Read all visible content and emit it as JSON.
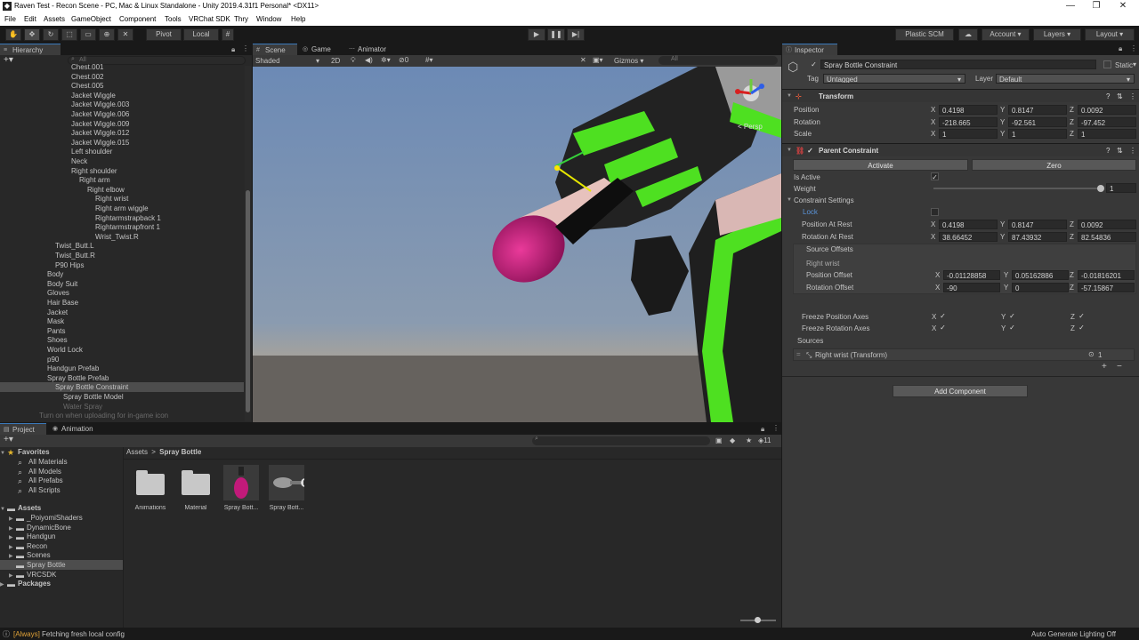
{
  "window": {
    "title": "Raven Test - Recon Scene - PC, Mac & Linux Standalone - Unity 2019.4.31f1 Personal* <DX11>"
  },
  "menu": [
    "File",
    "Edit",
    "Assets",
    "GameObject",
    "Component",
    "Tools",
    "VRChat SDK",
    "Thry",
    "Window",
    "Help"
  ],
  "toolbar": {
    "pivot": "Pivot",
    "local": "Local",
    "plastic": "Plastic SCM",
    "account": "Account",
    "layers": "Layers",
    "layout": "Layout"
  },
  "hierarchy": {
    "tab": "Hierarchy",
    "search_placeholder": "All",
    "rows": [
      {
        "label": "Chest.001",
        "indent": 0,
        "arrow": "",
        "style": "cut"
      },
      {
        "label": "Chest.002",
        "indent": 0,
        "arrow": "▶"
      },
      {
        "label": "Chest.005",
        "indent": 0,
        "arrow": "▶"
      },
      {
        "label": "Jacket Wiggle",
        "indent": 0,
        "arrow": "▶"
      },
      {
        "label": "Jacket Wiggle.003",
        "indent": 0,
        "arrow": "▶"
      },
      {
        "label": "Jacket Wiggle.006",
        "indent": 0,
        "arrow": "▶"
      },
      {
        "label": "Jacket Wiggle.009",
        "indent": 0,
        "arrow": "▶"
      },
      {
        "label": "Jacket Wiggle.012",
        "indent": 0,
        "arrow": "▶"
      },
      {
        "label": "Jacket Wiggle.015",
        "indent": 0,
        "arrow": "▶"
      },
      {
        "label": "Left shoulder",
        "indent": 0,
        "arrow": "▶"
      },
      {
        "label": "Neck",
        "indent": 0,
        "arrow": "▶"
      },
      {
        "label": "Right shoulder",
        "indent": 0,
        "arrow": "▼"
      },
      {
        "label": "Right arm",
        "indent": 1,
        "arrow": "▼"
      },
      {
        "label": "Right elbow",
        "indent": 2,
        "arrow": "▼"
      },
      {
        "label": "Right wrist",
        "indent": 3,
        "arrow": "▶"
      },
      {
        "label": "Right arm wiggle",
        "indent": 3,
        "arrow": "▶"
      },
      {
        "label": "Rightarmstrapback 1",
        "indent": 3,
        "arrow": "▶"
      },
      {
        "label": "Rightarmstrapfront 1",
        "indent": 3,
        "arrow": "▶"
      },
      {
        "label": "Wrist_Twist.R",
        "indent": 3,
        "arrow": "▶"
      },
      {
        "label": "Twist_Butt.L",
        "indent": -2,
        "arrow": "▶"
      },
      {
        "label": "Twist_Butt.R",
        "indent": -2,
        "arrow": "▶"
      },
      {
        "label": "P90 Hips",
        "indent": -2,
        "arrow": ""
      },
      {
        "label": "Body",
        "indent": -3,
        "arrow": ""
      },
      {
        "label": "Body Suit",
        "indent": -3,
        "arrow": ""
      },
      {
        "label": "Gloves",
        "indent": -3,
        "arrow": ""
      },
      {
        "label": "Hair Base",
        "indent": -3,
        "arrow": ""
      },
      {
        "label": "Jacket",
        "indent": -3,
        "arrow": ""
      },
      {
        "label": "Mask",
        "indent": -3,
        "arrow": ""
      },
      {
        "label": "Pants",
        "indent": -3,
        "arrow": ""
      },
      {
        "label": "Shoes",
        "indent": -3,
        "arrow": ""
      },
      {
        "label": "World Lock",
        "indent": -3,
        "arrow": "▶"
      },
      {
        "label": "p90",
        "indent": -3,
        "arrow": "▶"
      },
      {
        "label": "Handgun Prefab",
        "indent": -3,
        "arrow": "▶"
      },
      {
        "label": "Spray Bottle Prefab",
        "indent": -3,
        "arrow": "▼"
      },
      {
        "label": "Spray Bottle Constraint",
        "indent": -2,
        "arrow": "▼",
        "style": "sel"
      },
      {
        "label": "Spray Bottle Model",
        "indent": -1,
        "arrow": ""
      },
      {
        "label": "Water Spray",
        "indent": -1,
        "arrow": "",
        "style": "dim"
      },
      {
        "label": "Turn on when uploading for in-game icon",
        "indent": -4,
        "arrow": "",
        "style": "dim"
      }
    ]
  },
  "scene": {
    "tabs": [
      "Scene",
      "Game",
      "Animator"
    ],
    "shading": "Shaded",
    "mode2d": "2D",
    "gizmos": "Gizmos",
    "search": "All",
    "persp": "< Persp",
    "count": "0"
  },
  "inspector": {
    "tab": "Inspector",
    "object_name": "Spray Bottle Constraint",
    "static_label": "Static",
    "tag_label": "Tag",
    "tag_value": "Untagged",
    "layer_label": "Layer",
    "layer_value": "Default",
    "transform": {
      "header": "Transform",
      "rows": [
        {
          "label": "Position",
          "x": "0.4198",
          "y": "0.8147",
          "z": "0.0092"
        },
        {
          "label": "Rotation",
          "x": "-218.665",
          "y": "-92.561",
          "z": "-97.452"
        },
        {
          "label": "Scale",
          "x": "1",
          "y": "1",
          "z": "1"
        }
      ]
    },
    "parent_constraint": {
      "header": "Parent Constraint",
      "activate": "Activate",
      "zero": "Zero",
      "is_active_label": "Is Active",
      "weight_label": "Weight",
      "weight_value": "1",
      "settings_label": "Constraint Settings",
      "lock_label": "Lock",
      "pos_rest": {
        "label": "Position At Rest",
        "x": "0.4198",
        "y": "0.8147",
        "z": "0.0092"
      },
      "rot_rest": {
        "label": "Rotation At Rest",
        "x": "38.66452",
        "y": "87.43932",
        "z": "82.54836"
      },
      "source_offsets_label": "Source Offsets",
      "source_name": "Right wrist",
      "pos_offset": {
        "label": "Position Offset",
        "x": "-0.01128858",
        "y": "0.05162886",
        "z": "-0.01816201"
      },
      "rot_offset": {
        "label": "Rotation Offset",
        "x": "-90",
        "y": "0",
        "z": "-57.15867"
      },
      "freeze_pos_label": "Freeze Position Axes",
      "freeze_rot_label": "Freeze Rotation Axes",
      "sources_label": "Sources",
      "source_item": "Right wrist (Transform)",
      "source_weight": "1"
    },
    "add_component": "Add Component"
  },
  "project": {
    "tabs": [
      "Project",
      "Animation"
    ],
    "breadcrumb": [
      "Assets",
      "Spray Bottle"
    ],
    "badge": "11",
    "favorites_label": "Favorites",
    "favorites": [
      "All Materials",
      "All Models",
      "All Prefabs",
      "All Scripts"
    ],
    "assets_label": "Assets",
    "folders": [
      "_PoiyomiShaders",
      "DynamicBone",
      "Handgun",
      "Recon",
      "Scenes",
      "Spray Bottle",
      "VRCSDK"
    ],
    "packages_label": "Packages",
    "items": [
      {
        "label": "Animations",
        "kind": "folder"
      },
      {
        "label": "Material",
        "kind": "folder"
      },
      {
        "label": "Spray Bott...",
        "kind": "bottle"
      },
      {
        "label": "Spray Bott...",
        "kind": "model"
      }
    ]
  },
  "status": {
    "tag": "[Always]",
    "message": " Fetching fresh local config",
    "right": "Auto Generate Lighting Off"
  },
  "colors": {
    "accent": "#3a79bb",
    "green_strap": "#4ee021",
    "bottle": "#c21a7a",
    "sky": "#6f8bb5"
  }
}
